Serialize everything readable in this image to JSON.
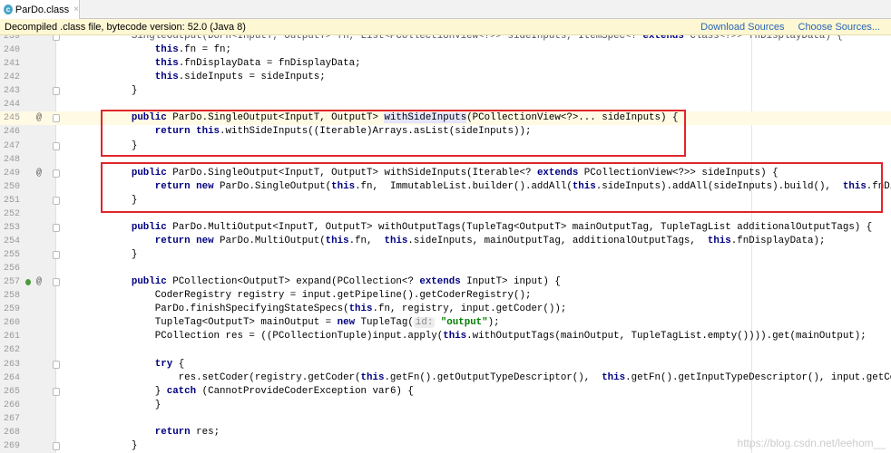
{
  "tab": {
    "icon": "class-file-icon",
    "label": "ParDo.class",
    "close": "×"
  },
  "banner": {
    "text": "Decompiled .class file, bytecode version: 52.0 (Java 8)",
    "download": "Download Sources",
    "choose": "Choose Sources..."
  },
  "watermark": "https://blog.csdn.net/leehom__",
  "colors": {
    "highlight_box": "#e0262b",
    "keyword": "#000080",
    "string": "#008000",
    "caret_line": "#fffae3"
  },
  "lines": [
    {
      "n": "239",
      "fold": true,
      "s": [
        [
          "        SingleOutput(DoFn<InputT, OutputT> fn, List<PCollectionView<?>> sideInputs, ItemSpec<? ",
          "dim"
        ],
        [
          "extends",
          "kw"
        ],
        [
          " Class<?>> fnDisplayData) {",
          "dim"
        ]
      ]
    },
    {
      "n": "240",
      "s": [
        [
          "            ",
          ""
        ],
        [
          "this",
          "kw"
        ],
        [
          ".fn = fn;",
          ""
        ]
      ]
    },
    {
      "n": "241",
      "s": [
        [
          "            ",
          ""
        ],
        [
          "this",
          "kw"
        ],
        [
          ".fnDisplayData = fnDisplayData;",
          ""
        ]
      ]
    },
    {
      "n": "242",
      "s": [
        [
          "            ",
          ""
        ],
        [
          "this",
          "kw"
        ],
        [
          ".sideInputs = sideInputs;",
          ""
        ]
      ]
    },
    {
      "n": "243",
      "fold": true,
      "s": [
        [
          "        }",
          ""
        ]
      ]
    },
    {
      "n": "244",
      "s": []
    },
    {
      "n": "245",
      "at": true,
      "fold": true,
      "caret": true,
      "s": [
        [
          "        ",
          ""
        ],
        [
          "public",
          "kw"
        ],
        [
          " ParDo.SingleOutput<InputT, OutputT> ",
          ""
        ],
        [
          "withSideInputs",
          "sel"
        ],
        [
          "(PCollectionView<?>... sideInputs) {",
          ""
        ]
      ]
    },
    {
      "n": "246",
      "s": [
        [
          "            ",
          ""
        ],
        [
          "return this",
          "kw"
        ],
        [
          ".withSideInputs((Iterable)Arrays.asList(sideInputs));",
          ""
        ]
      ]
    },
    {
      "n": "247",
      "fold": true,
      "s": [
        [
          "        }",
          ""
        ]
      ]
    },
    {
      "n": "248",
      "s": []
    },
    {
      "n": "249",
      "at": true,
      "fold": true,
      "s": [
        [
          "        ",
          ""
        ],
        [
          "public",
          "kw"
        ],
        [
          " ParDo.SingleOutput<InputT, OutputT> withSideInputs(Iterable<? ",
          ""
        ],
        [
          "extends",
          "kw"
        ],
        [
          " PCollectionView<?>> sideInputs) {",
          ""
        ]
      ]
    },
    {
      "n": "250",
      "s": [
        [
          "            ",
          ""
        ],
        [
          "return new",
          "kw"
        ],
        [
          " ParDo.SingleOutput(",
          ""
        ],
        [
          "this",
          "kw"
        ],
        [
          ".fn,  ImmutableList.builder().addAll(",
          ""
        ],
        [
          "this",
          "kw"
        ],
        [
          ".sideInputs).addAll(sideInputs).build(),  ",
          ""
        ],
        [
          "this",
          "kw"
        ],
        [
          ".fnDisplayData);",
          ""
        ]
      ]
    },
    {
      "n": "251",
      "fold": true,
      "s": [
        [
          "        }",
          ""
        ]
      ]
    },
    {
      "n": "252",
      "s": []
    },
    {
      "n": "253",
      "fold": true,
      "s": [
        [
          "        ",
          ""
        ],
        [
          "public",
          "kw"
        ],
        [
          " ParDo.MultiOutput<InputT, OutputT> withOutputTags(TupleTag<OutputT> mainOutputTag, TupleTagList additionalOutputTags) {",
          ""
        ]
      ]
    },
    {
      "n": "254",
      "s": [
        [
          "            ",
          ""
        ],
        [
          "return new",
          "kw"
        ],
        [
          " ParDo.MultiOutput(",
          ""
        ],
        [
          "this",
          "kw"
        ],
        [
          ".fn,  ",
          ""
        ],
        [
          "this",
          "kw"
        ],
        [
          ".sideInputs, mainOutputTag, additionalOutputTags,  ",
          ""
        ],
        [
          "this",
          "kw"
        ],
        [
          ".fnDisplayData);",
          ""
        ]
      ]
    },
    {
      "n": "255",
      "fold": true,
      "s": [
        [
          "        }",
          ""
        ]
      ]
    },
    {
      "n": "256",
      "s": []
    },
    {
      "n": "257",
      "at": true,
      "override": true,
      "fold": true,
      "s": [
        [
          "        ",
          ""
        ],
        [
          "public",
          "kw"
        ],
        [
          " PCollection<OutputT> expand(PCollection<? ",
          ""
        ],
        [
          "extends",
          "kw"
        ],
        [
          " InputT> input) {",
          ""
        ]
      ]
    },
    {
      "n": "258",
      "s": [
        [
          "            CoderRegistry registry = input.getPipeline().getCoderRegistry();",
          ""
        ]
      ]
    },
    {
      "n": "259",
      "s": [
        [
          "            ParDo.finishSpecifyingStateSpecs(",
          ""
        ],
        [
          "this",
          "kw"
        ],
        [
          ".fn, registry, input.getCoder());",
          ""
        ]
      ]
    },
    {
      "n": "260",
      "s": [
        [
          "            TupleTag<OutputT> mainOutput = ",
          ""
        ],
        [
          "new",
          "kw"
        ],
        [
          " TupleTag(",
          ""
        ],
        [
          "id:",
          "hint"
        ],
        [
          " ",
          ""
        ],
        [
          "\"output\"",
          "str"
        ],
        [
          ");",
          ""
        ]
      ]
    },
    {
      "n": "261",
      "s": [
        [
          "            PCollection res = ((PCollectionTuple)input.apply(",
          ""
        ],
        [
          "this",
          "kw"
        ],
        [
          ".withOutputTags(mainOutput, TupleTagList.empty()))).get(mainOutput);",
          ""
        ]
      ]
    },
    {
      "n": "262",
      "s": []
    },
    {
      "n": "263",
      "fold": true,
      "s": [
        [
          "            ",
          ""
        ],
        [
          "try",
          "kw"
        ],
        [
          " {",
          ""
        ]
      ]
    },
    {
      "n": "264",
      "s": [
        [
          "                res.setCoder(registry.getCoder(",
          ""
        ],
        [
          "this",
          "kw"
        ],
        [
          ".getFn().getOutputTypeDescriptor(),  ",
          ""
        ],
        [
          "this",
          "kw"
        ],
        [
          ".getFn().getInputTypeDescriptor(), input.getCoder()));",
          ""
        ]
      ]
    },
    {
      "n": "265",
      "fold": true,
      "s": [
        [
          "            } ",
          ""
        ],
        [
          "catch",
          "kw"
        ],
        [
          " (CannotProvideCoderException var6) {",
          ""
        ]
      ]
    },
    {
      "n": "266",
      "s": [
        [
          "            }",
          ""
        ]
      ]
    },
    {
      "n": "267",
      "s": []
    },
    {
      "n": "268",
      "s": [
        [
          "            ",
          ""
        ],
        [
          "return",
          "kw"
        ],
        [
          " res;",
          ""
        ]
      ]
    },
    {
      "n": "269",
      "fold": true,
      "s": [
        [
          "        }",
          ""
        ]
      ]
    }
  ]
}
